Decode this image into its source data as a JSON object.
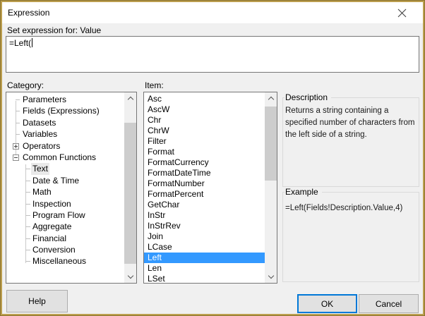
{
  "window": {
    "title": "Expression",
    "border_color": "#bb9e4e"
  },
  "header": {
    "set_expression_label": "Set expression for: Value"
  },
  "expression_editor": {
    "value": "=Left("
  },
  "category_panel": {
    "label": "Category:",
    "tree": [
      {
        "label": "Parameters",
        "level": 0,
        "glyph": null,
        "selected": false
      },
      {
        "label": "Fields (Expressions)",
        "level": 0,
        "glyph": null,
        "selected": false
      },
      {
        "label": "Datasets",
        "level": 0,
        "glyph": null,
        "selected": false
      },
      {
        "label": "Variables",
        "level": 0,
        "glyph": null,
        "selected": false
      },
      {
        "label": "Operators",
        "level": 0,
        "glyph": "plus",
        "selected": false
      },
      {
        "label": "Common Functions",
        "level": 0,
        "glyph": "minus",
        "selected": false
      },
      {
        "label": "Text",
        "level": 1,
        "glyph": null,
        "selected": true
      },
      {
        "label": "Date & Time",
        "level": 1,
        "glyph": null,
        "selected": false
      },
      {
        "label": "Math",
        "level": 1,
        "glyph": null,
        "selected": false
      },
      {
        "label": "Inspection",
        "level": 1,
        "glyph": null,
        "selected": false
      },
      {
        "label": "Program Flow",
        "level": 1,
        "glyph": null,
        "selected": false
      },
      {
        "label": "Aggregate",
        "level": 1,
        "glyph": null,
        "selected": false
      },
      {
        "label": "Financial",
        "level": 1,
        "glyph": null,
        "selected": false
      },
      {
        "label": "Conversion",
        "level": 1,
        "glyph": null,
        "selected": false
      },
      {
        "label": "Miscellaneous",
        "level": 1,
        "glyph": null,
        "selected": false
      }
    ]
  },
  "item_panel": {
    "label": "Item:",
    "items": [
      "Asc",
      "AscW",
      "Chr",
      "ChrW",
      "Filter",
      "Format",
      "FormatCurrency",
      "FormatDateTime",
      "FormatNumber",
      "FormatPercent",
      "GetChar",
      "InStr",
      "InStrRev",
      "Join",
      "LCase",
      "Left",
      "Len",
      "LSet"
    ],
    "selected_item": "Left"
  },
  "description_panel": {
    "title": "Description",
    "text": "Returns a string containing a\nspecified number of characters from\nthe left side of a string."
  },
  "example_panel": {
    "title": "Example",
    "code": "=Left(Fields!Description.Value,4)"
  },
  "buttons": {
    "help": "Help",
    "ok": "OK",
    "cancel": "Cancel"
  },
  "colors": {
    "selection_blue": "#3399ff",
    "accent_blue": "#0078d7",
    "window_border_gold": "#bb9e4e",
    "button_bg": "#e1e1e1",
    "body_bg": "#f0f0f0"
  }
}
